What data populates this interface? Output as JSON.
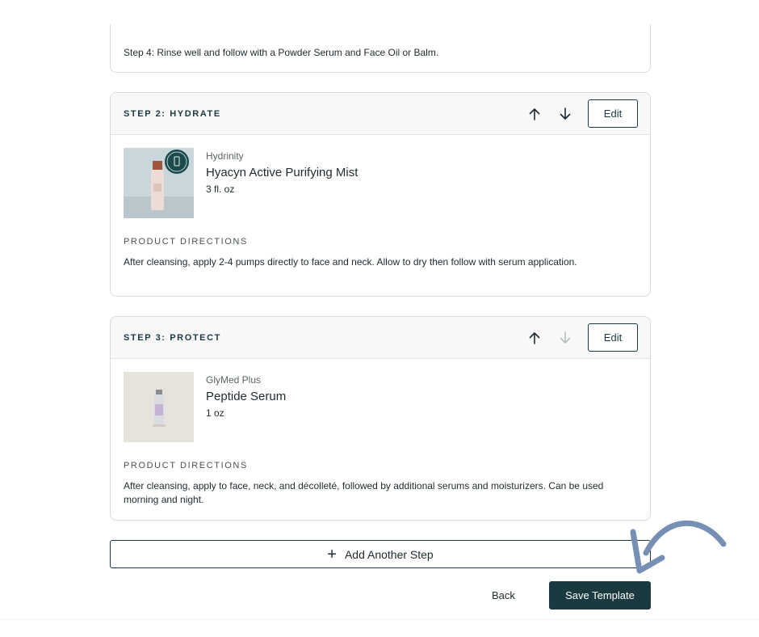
{
  "top_card": {
    "text": "Step 4: Rinse well and follow with a Powder Serum and Face Oil or Balm."
  },
  "steps": [
    {
      "title": "STEP 2: HYDRATE",
      "edit_label": "Edit",
      "product": {
        "brand": "Hydrinity",
        "name": "Hyacyn Active Purifying Mist",
        "size": "3 fl. oz"
      },
      "directions_label": "PRODUCT DIRECTIONS",
      "directions": "After cleansing, apply 2-4 pumps directly to face and neck. Allow to dry then follow with serum application."
    },
    {
      "title": "STEP 3: PROTECT",
      "edit_label": "Edit",
      "product": {
        "brand": "GlyMed Plus",
        "name": "Peptide Serum",
        "size": "1 oz"
      },
      "directions_label": "PRODUCT DIRECTIONS",
      "directions": "After cleansing, apply to face, neck, and décolleté, followed by additional serums and moisturizers. Can be used morning and night."
    }
  ],
  "add_step_label": "Add Another Step",
  "back_label": "Back",
  "save_label": "Save Template",
  "colors": {
    "primary": "#1b3a40",
    "border": "#d7dcde",
    "header_bg": "#f8f8f8",
    "annotation_arrow": "#7590b4"
  },
  "icons": {
    "up": "arrow-up-icon",
    "down": "arrow-down-icon",
    "plus": "plus-icon"
  }
}
